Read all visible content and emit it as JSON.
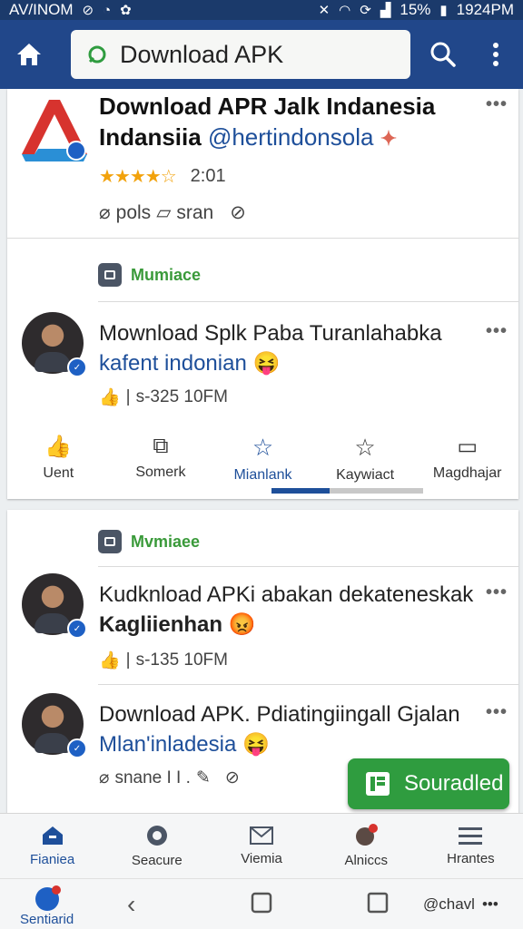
{
  "status_bar": {
    "carrier": "AV/INOM",
    "battery": "15%",
    "time": "1924PM"
  },
  "search": {
    "query": "Download APK"
  },
  "card1": {
    "app": {
      "title_line1": "Download APR Jalk Indanesia",
      "title_line2_a": "Indansiia",
      "title_line2_b": "@hertindonsola",
      "rating_text": "2:01",
      "tag1": "pols",
      "tag2": "sran"
    },
    "section_label": "Mumiace",
    "post": {
      "line1": "Mownload Splk Paba Turanlahabka",
      "line2": "kafent indonian",
      "meta": "s-325 10FM"
    },
    "actions": [
      "Uent",
      "Somerk",
      "Mianlank",
      "Kaywiact",
      "Magdhajar"
    ]
  },
  "card2": {
    "section_label": "Mvmiaee",
    "post1": {
      "line1": "Kudknload APKi abakan dekateneskak",
      "line2": "Kagliienhan",
      "meta": "s-135 10FM"
    },
    "post2": {
      "line1": "Download APK. Pdiatingiingall Gjalan",
      "line2": "Mlan'inladesia",
      "meta": "snane I I ."
    }
  },
  "fab": {
    "label": "Souradled"
  },
  "bottom_nav": [
    "Fianiea",
    "Seacure",
    "Viemia",
    "Alniccs",
    "Hrantes"
  ],
  "sys_bar": {
    "left_label": "Sentiarid",
    "right_label": "@chavl"
  },
  "colors": {
    "toolbar": "#21478a",
    "accent_green": "#2f9c3f",
    "link_blue": "#1e4f9a"
  }
}
